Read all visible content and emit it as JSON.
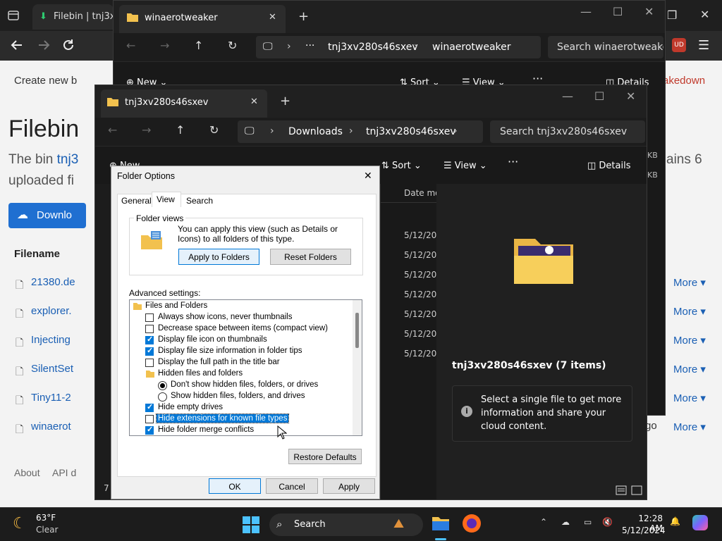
{
  "browser": {
    "tabs": [
      {
        "label": "Filebin | tnj3xv2"
      }
    ],
    "page": {
      "create_new": "Create new b",
      "title": "Filebin",
      "desc_start": "The bin ",
      "desc_link": "tnj3",
      "desc_line2": "uploaded fi",
      "desc_right": "ains 6",
      "download_btn": "Downlo",
      "filename_header": "Filename",
      "takedown": "akedown",
      "files": [
        "21380.de",
        "explorer.",
        "Injecting",
        "SilentSet",
        "Tiny11-2",
        "winaerot"
      ],
      "more_label": "More",
      "size_suffix": "KB",
      "ago": "go",
      "footer_about": "About",
      "footer_api": "API d"
    }
  },
  "explorer_back": {
    "tab_title": "winaerotweaker",
    "breadcrumb": [
      "tnj3xv280s46sxev",
      "winaerotweaker"
    ],
    "search_placeholder": "Search winaerotweaker",
    "toolbar": {
      "new": "New",
      "sort": "Sort",
      "view": "View",
      "details": "Details"
    }
  },
  "explorer_front": {
    "tab_title": "tnj3xv280s46sxev",
    "breadcrumb": [
      "Downloads",
      "tnj3xv280s46sxev"
    ],
    "search_placeholder": "Search tnj3xv280s46sxev",
    "toolbar": {
      "new": "New",
      "sort": "Sort",
      "view": "View",
      "details": "Details"
    },
    "column_date": "Date mo",
    "dates": [
      "5/12/202",
      "5/12/202",
      "5/12/202",
      "5/12/202",
      "5/12/202",
      "5/12/202",
      "5/12/202"
    ],
    "first_name_fragment": "n",
    "details_title": "tnj3xv280s46sxev (7 items)",
    "details_info": "Select a single file to get more information and share your cloud content.",
    "left_count": "7"
  },
  "folder_options": {
    "title": "Folder Options",
    "tabs": [
      "General",
      "View",
      "Search"
    ],
    "folder_views_label": "Folder views",
    "folder_views_desc": "You can apply this view (such as Details or Icons) to all folders of this type.",
    "apply_to_folders": "Apply to Folders",
    "reset_folders": "Reset Folders",
    "advanced_label": "Advanced settings:",
    "tree": [
      {
        "label": "Files and Folders",
        "kind": "folder",
        "indent": 0
      },
      {
        "label": "Always show icons, never thumbnails",
        "kind": "check",
        "checked": false,
        "indent": 1
      },
      {
        "label": "Decrease space between items (compact view)",
        "kind": "check",
        "checked": false,
        "indent": 1
      },
      {
        "label": "Display file icon on thumbnails",
        "kind": "check",
        "checked": true,
        "indent": 1
      },
      {
        "label": "Display file size information in folder tips",
        "kind": "check",
        "checked": true,
        "indent": 1
      },
      {
        "label": "Display the full path in the title bar",
        "kind": "check",
        "checked": false,
        "indent": 1
      },
      {
        "label": "Hidden files and folders",
        "kind": "folder",
        "indent": 1
      },
      {
        "label": "Don't show hidden files, folders, or drives",
        "kind": "radio",
        "checked": true,
        "indent": 2
      },
      {
        "label": "Show hidden files, folders, and drives",
        "kind": "radio",
        "checked": false,
        "indent": 2
      },
      {
        "label": "Hide empty drives",
        "kind": "check",
        "checked": true,
        "indent": 1
      },
      {
        "label": "Hide extensions for known file types",
        "kind": "check",
        "checked": false,
        "indent": 1,
        "selected": true
      },
      {
        "label": "Hide folder merge conflicts",
        "kind": "check",
        "checked": true,
        "indent": 1
      }
    ],
    "restore_defaults": "Restore Defaults",
    "ok": "OK",
    "cancel": "Cancel",
    "apply": "Apply"
  },
  "taskbar": {
    "weather_temp": "63°F",
    "weather_desc": "Clear",
    "search_label": "Search",
    "time": "12:28 AM",
    "date": "5/12/2024"
  }
}
